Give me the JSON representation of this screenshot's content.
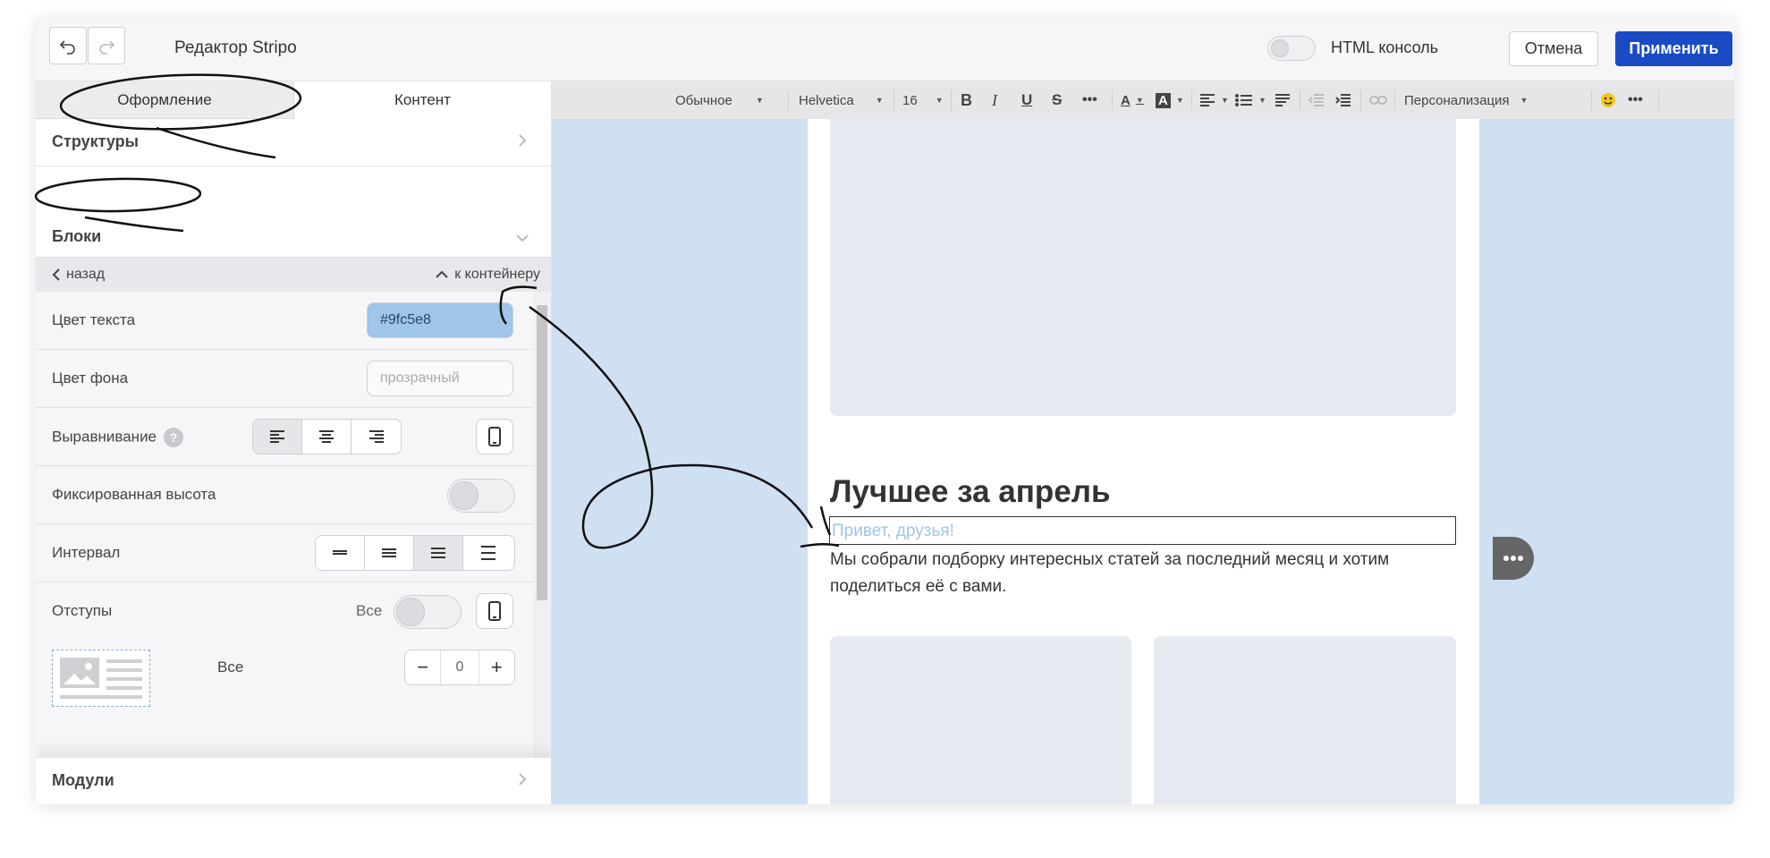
{
  "header": {
    "title": "Редактор Stripo",
    "console_label": "HTML консоль",
    "cancel_label": "Отмена",
    "apply_label": "Применить",
    "undo_icon": "undo-icon",
    "redo_icon": "redo-icon"
  },
  "left_panel": {
    "tabs": [
      "Оформление",
      "Контент"
    ],
    "sections": {
      "structures": "Структуры",
      "blocks": "Блоки",
      "modules": "Модули"
    },
    "back_label": "назад",
    "to_container_label": "к контейнеру",
    "properties": {
      "text_color": {
        "label": "Цвет текста",
        "value": "#9fc5e8"
      },
      "bg_color": {
        "label": "Цвет фона",
        "placeholder": "прозрачный"
      },
      "alignment": {
        "label": "Выравнивание",
        "help": "?"
      },
      "fixed_height": {
        "label": "Фиксированная высота"
      },
      "spacing": {
        "label": "Интервал"
      },
      "paddings": {
        "label": "Отступы",
        "all_label": "Все",
        "all_label_2": "Все",
        "value": "0"
      }
    }
  },
  "toolbar": {
    "format": "Обычное",
    "font": "Helvetica",
    "size": "16",
    "personalization": "Персонализация"
  },
  "email": {
    "heading": "Лучшее за апрель",
    "greeting": "Привет, друзья!",
    "paragraph": "Мы собрали подборку интересных статей за последний месяц и хотим поделиться её с вами."
  },
  "colors": {
    "accent": "#1a4bc4",
    "text_color_value": "#9fc5e8",
    "canvas_bg": "#cfe0f2"
  }
}
